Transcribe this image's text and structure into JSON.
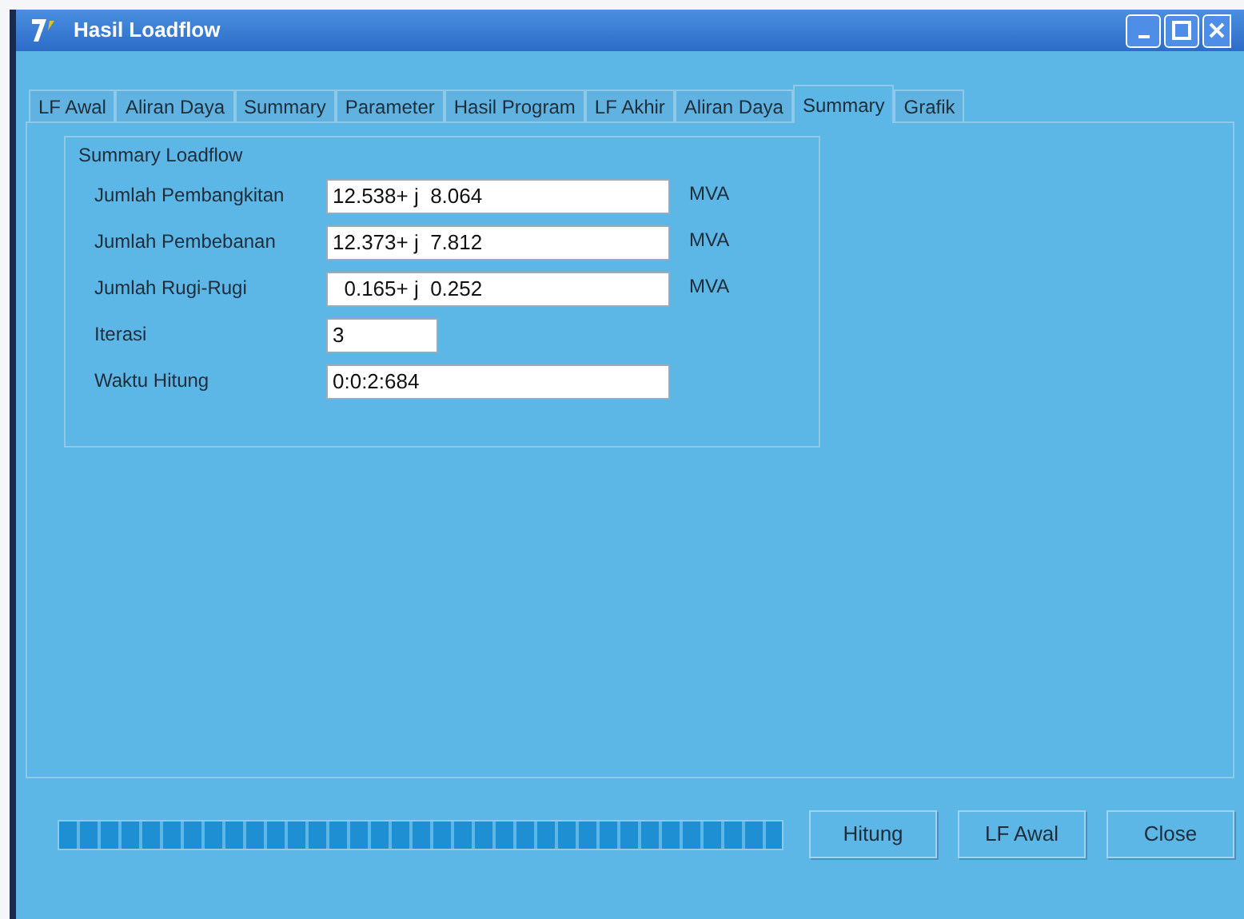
{
  "window": {
    "title": "Hasil Loadflow"
  },
  "tabs": [
    {
      "label": "LF Awal",
      "selected": false
    },
    {
      "label": "Aliran Daya",
      "selected": false
    },
    {
      "label": "Summary",
      "selected": false
    },
    {
      "label": "Parameter",
      "selected": false
    },
    {
      "label": "Hasil Program",
      "selected": false
    },
    {
      "label": "LF Akhir",
      "selected": false
    },
    {
      "label": "Aliran Daya",
      "selected": false
    },
    {
      "label": "Summary",
      "selected": true
    },
    {
      "label": "Grafik",
      "selected": false
    }
  ],
  "group": {
    "title": "Summary Loadflow",
    "fields": [
      {
        "label": "Jumlah Pembangkitan",
        "value": "12.538+ j  8.064",
        "unit": "MVA"
      },
      {
        "label": "Jumlah Pembebanan",
        "value": "12.373+ j  7.812",
        "unit": "MVA"
      },
      {
        "label": "Jumlah Rugi-Rugi",
        "value": "  0.165+ j  0.252",
        "unit": "MVA"
      },
      {
        "label": "Iterasi",
        "value": "3"
      },
      {
        "label": "Waktu Hitung",
        "value": "0:0:2:684"
      }
    ]
  },
  "progress": {
    "level": 1
  },
  "buttons": [
    "Hitung",
    "LF Awal",
    "Close"
  ]
}
